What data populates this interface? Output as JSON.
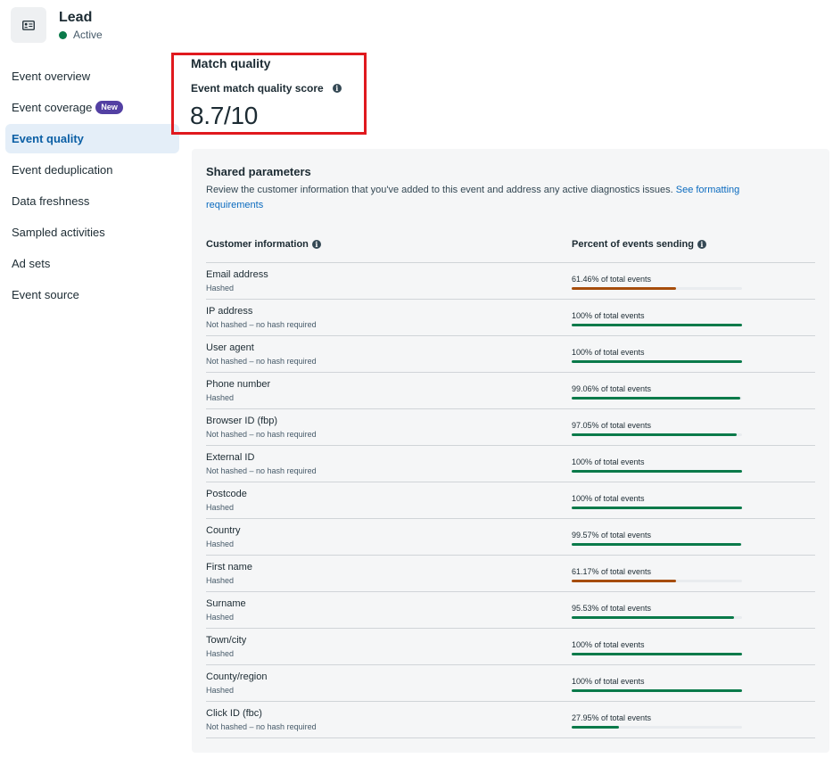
{
  "event": {
    "icon": "id-card-icon",
    "title": "Lead",
    "status": "Active",
    "status_color": "#0a7a4a"
  },
  "sidebar": {
    "items": [
      {
        "label": "Event overview"
      },
      {
        "label": "Event coverage",
        "badge": "New"
      },
      {
        "label": "Event quality",
        "active": true
      },
      {
        "label": "Event deduplication"
      },
      {
        "label": "Data freshness"
      },
      {
        "label": "Sampled activities"
      },
      {
        "label": "Ad sets"
      },
      {
        "label": "Event source"
      }
    ]
  },
  "match_quality": {
    "title": "Match quality",
    "subtitle": "Event match quality score",
    "score": "8.7/10",
    "highlight_color": "#e0191e"
  },
  "shared_parameters": {
    "title": "Shared parameters",
    "description": "Review the customer information that you've added to this event and address any active diagnostics issues.",
    "link_text": "See formatting requirements",
    "columns": [
      "Customer information",
      "Percent of events sending"
    ],
    "colors": {
      "good": "#0a7a4a",
      "warning": "#a64d0c"
    },
    "rows": [
      {
        "name": "Email address",
        "hash": "Hashed",
        "percent_text": "61.46% of total events",
        "percent": 61.46,
        "status": "warning"
      },
      {
        "name": "IP address",
        "hash": "Not hashed – no hash required",
        "percent_text": "100% of total events",
        "percent": 100,
        "status": "good"
      },
      {
        "name": "User agent",
        "hash": "Not hashed – no hash required",
        "percent_text": "100% of total events",
        "percent": 100,
        "status": "good"
      },
      {
        "name": "Phone number",
        "hash": "Hashed",
        "percent_text": "99.06% of total events",
        "percent": 99.06,
        "status": "good"
      },
      {
        "name": "Browser ID (fbp)",
        "hash": "Not hashed – no hash required",
        "percent_text": "97.05% of total events",
        "percent": 97.05,
        "status": "good"
      },
      {
        "name": "External ID",
        "hash": "Not hashed – no hash required",
        "percent_text": "100% of total events",
        "percent": 100,
        "status": "good"
      },
      {
        "name": "Postcode",
        "hash": "Hashed",
        "percent_text": "100% of total events",
        "percent": 100,
        "status": "good"
      },
      {
        "name": "Country",
        "hash": "Hashed",
        "percent_text": "99.57% of total events",
        "percent": 99.57,
        "status": "good"
      },
      {
        "name": "First name",
        "hash": "Hashed",
        "percent_text": "61.17% of total events",
        "percent": 61.17,
        "status": "warning"
      },
      {
        "name": "Surname",
        "hash": "Hashed",
        "percent_text": "95.53% of total events",
        "percent": 95.53,
        "status": "good"
      },
      {
        "name": "Town/city",
        "hash": "Hashed",
        "percent_text": "100% of total events",
        "percent": 100,
        "status": "good"
      },
      {
        "name": "County/region",
        "hash": "Hashed",
        "percent_text": "100% of total events",
        "percent": 100,
        "status": "good"
      },
      {
        "name": "Click ID (fbc)",
        "hash": "Not hashed – no hash required",
        "percent_text": "27.95% of total events",
        "percent": 27.95,
        "status": "good"
      }
    ]
  }
}
